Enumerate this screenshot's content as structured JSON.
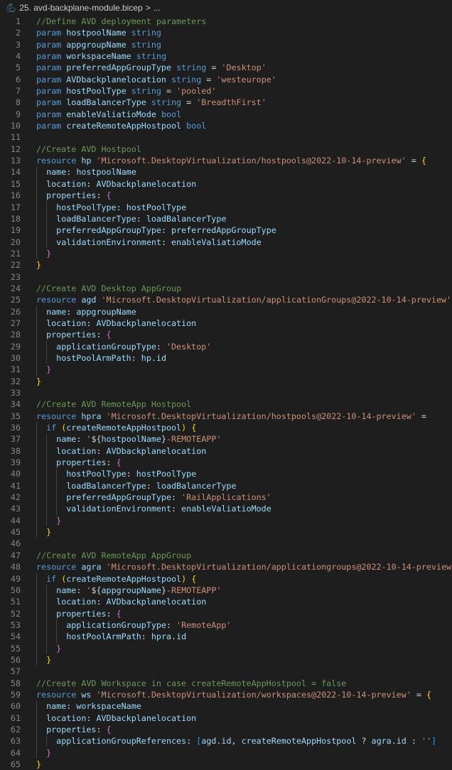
{
  "breadcrumb": {
    "file_icon": "bicep-icon",
    "file_name": "25. avd-backplane-module.bicep",
    "separator": ">",
    "more": "..."
  },
  "colors": {
    "comment": "#6a9955",
    "keyword": "#569cd6",
    "identifier": "#9cdcfe",
    "string": "#ce9178",
    "punctuation": "#d4d4d4",
    "bracket1": "#ffd700",
    "bracket2": "#da70d6",
    "bracket3": "#179fff",
    "line_number": "#858585",
    "background": "#1e1e1e"
  },
  "lines": [
    {
      "n": "1",
      "indent": 0,
      "tokens": [
        [
          "c",
          "//Define AVD deployment parameters"
        ]
      ]
    },
    {
      "n": "2",
      "indent": 0,
      "tokens": [
        [
          "k",
          "param"
        ],
        [
          "p",
          " "
        ],
        [
          "i",
          "hostpoolName"
        ],
        [
          "p",
          " "
        ],
        [
          "k",
          "string"
        ]
      ]
    },
    {
      "n": "3",
      "indent": 0,
      "tokens": [
        [
          "k",
          "param"
        ],
        [
          "p",
          " "
        ],
        [
          "i",
          "appgroupName"
        ],
        [
          "p",
          " "
        ],
        [
          "k",
          "string"
        ]
      ]
    },
    {
      "n": "4",
      "indent": 0,
      "tokens": [
        [
          "k",
          "param"
        ],
        [
          "p",
          " "
        ],
        [
          "i",
          "workspaceName"
        ],
        [
          "p",
          " "
        ],
        [
          "k",
          "string"
        ]
      ]
    },
    {
      "n": "5",
      "indent": 0,
      "tokens": [
        [
          "k",
          "param"
        ],
        [
          "p",
          " "
        ],
        [
          "i",
          "preferredAppGroupType"
        ],
        [
          "p",
          " "
        ],
        [
          "k",
          "string"
        ],
        [
          "p",
          " = "
        ],
        [
          "s",
          "'Desktop'"
        ]
      ]
    },
    {
      "n": "6",
      "indent": 0,
      "tokens": [
        [
          "k",
          "param"
        ],
        [
          "p",
          " "
        ],
        [
          "i",
          "AVDbackplanelocation"
        ],
        [
          "p",
          " "
        ],
        [
          "k",
          "string"
        ],
        [
          "p",
          " = "
        ],
        [
          "s",
          "'westeurope'"
        ]
      ]
    },
    {
      "n": "7",
      "indent": 0,
      "tokens": [
        [
          "k",
          "param"
        ],
        [
          "p",
          " "
        ],
        [
          "i",
          "hostPoolType"
        ],
        [
          "p",
          " "
        ],
        [
          "k",
          "string"
        ],
        [
          "p",
          " = "
        ],
        [
          "s",
          "'pooled'"
        ]
      ]
    },
    {
      "n": "8",
      "indent": 0,
      "tokens": [
        [
          "k",
          "param"
        ],
        [
          "p",
          " "
        ],
        [
          "i",
          "loadBalancerType"
        ],
        [
          "p",
          " "
        ],
        [
          "k",
          "string"
        ],
        [
          "p",
          " = "
        ],
        [
          "s",
          "'BreadthFirst'"
        ]
      ]
    },
    {
      "n": "9",
      "indent": 0,
      "tokens": [
        [
          "k",
          "param"
        ],
        [
          "p",
          " "
        ],
        [
          "i",
          "enableValiatioMode"
        ],
        [
          "p",
          " "
        ],
        [
          "k",
          "bool"
        ]
      ]
    },
    {
      "n": "10",
      "indent": 0,
      "tokens": [
        [
          "k",
          "param"
        ],
        [
          "p",
          " "
        ],
        [
          "i",
          "createRemoteAppHostpool"
        ],
        [
          "p",
          " "
        ],
        [
          "k",
          "bool"
        ]
      ]
    },
    {
      "n": "11",
      "indent": 0,
      "tokens": []
    },
    {
      "n": "12",
      "indent": 0,
      "tokens": [
        [
          "c",
          "//Create AVD Hostpool"
        ]
      ]
    },
    {
      "n": "13",
      "indent": 0,
      "tokens": [
        [
          "k",
          "resource"
        ],
        [
          "p",
          " "
        ],
        [
          "i",
          "hp"
        ],
        [
          "p",
          " "
        ],
        [
          "s",
          "'Microsoft.DesktopVirtualization/hostpools@2022-10-14-preview'"
        ],
        [
          "p",
          " = "
        ],
        [
          "b1",
          "{"
        ]
      ]
    },
    {
      "n": "14",
      "indent": 1,
      "tokens": [
        [
          "p",
          "  "
        ],
        [
          "i",
          "name"
        ],
        [
          "p",
          ": "
        ],
        [
          "i",
          "hostpoolName"
        ]
      ]
    },
    {
      "n": "15",
      "indent": 1,
      "tokens": [
        [
          "p",
          "  "
        ],
        [
          "i",
          "location"
        ],
        [
          "p",
          ": "
        ],
        [
          "i",
          "AVDbackplanelocation"
        ]
      ]
    },
    {
      "n": "16",
      "indent": 1,
      "tokens": [
        [
          "p",
          "  "
        ],
        [
          "i",
          "properties"
        ],
        [
          "p",
          ": "
        ],
        [
          "b2",
          "{"
        ]
      ]
    },
    {
      "n": "17",
      "indent": 2,
      "tokens": [
        [
          "p",
          "    "
        ],
        [
          "i",
          "hostPoolType"
        ],
        [
          "p",
          ": "
        ],
        [
          "i",
          "hostPoolType"
        ]
      ]
    },
    {
      "n": "18",
      "indent": 2,
      "tokens": [
        [
          "p",
          "    "
        ],
        [
          "i",
          "loadBalancerType"
        ],
        [
          "p",
          ": "
        ],
        [
          "i",
          "loadBalancerType"
        ]
      ]
    },
    {
      "n": "19",
      "indent": 2,
      "tokens": [
        [
          "p",
          "    "
        ],
        [
          "i",
          "preferredAppGroupType"
        ],
        [
          "p",
          ": "
        ],
        [
          "i",
          "preferredAppGroupType"
        ]
      ]
    },
    {
      "n": "20",
      "indent": 2,
      "tokens": [
        [
          "p",
          "    "
        ],
        [
          "i",
          "validationEnvironment"
        ],
        [
          "p",
          ": "
        ],
        [
          "i",
          "enableValiatioMode"
        ]
      ]
    },
    {
      "n": "21",
      "indent": 1,
      "tokens": [
        [
          "p",
          "  "
        ],
        [
          "b2",
          "}"
        ]
      ]
    },
    {
      "n": "22",
      "indent": 0,
      "tokens": [
        [
          "b1",
          "}"
        ]
      ]
    },
    {
      "n": "23",
      "indent": 0,
      "tokens": []
    },
    {
      "n": "24",
      "indent": 0,
      "tokens": [
        [
          "c",
          "//Create AVD Desktop AppGroup"
        ]
      ]
    },
    {
      "n": "25",
      "indent": 0,
      "tokens": [
        [
          "k",
          "resource"
        ],
        [
          "p",
          " "
        ],
        [
          "i",
          "agd"
        ],
        [
          "p",
          " "
        ],
        [
          "s",
          "'Microsoft.DesktopVirtualization/applicationGroups@2022-10-14-preview'"
        ],
        [
          "p",
          " = "
        ],
        [
          "b1",
          "{"
        ]
      ]
    },
    {
      "n": "26",
      "indent": 1,
      "tokens": [
        [
          "p",
          "  "
        ],
        [
          "i",
          "name"
        ],
        [
          "p",
          ": "
        ],
        [
          "i",
          "appgroupName"
        ]
      ]
    },
    {
      "n": "27",
      "indent": 1,
      "tokens": [
        [
          "p",
          "  "
        ],
        [
          "i",
          "location"
        ],
        [
          "p",
          ": "
        ],
        [
          "i",
          "AVDbackplanelocation"
        ]
      ]
    },
    {
      "n": "28",
      "indent": 1,
      "tokens": [
        [
          "p",
          "  "
        ],
        [
          "i",
          "properties"
        ],
        [
          "p",
          ": "
        ],
        [
          "b2",
          "{"
        ]
      ]
    },
    {
      "n": "29",
      "indent": 2,
      "tokens": [
        [
          "p",
          "    "
        ],
        [
          "i",
          "applicationGroupType"
        ],
        [
          "p",
          ": "
        ],
        [
          "s",
          "'Desktop'"
        ]
      ]
    },
    {
      "n": "30",
      "indent": 2,
      "tokens": [
        [
          "p",
          "    "
        ],
        [
          "i",
          "hostPoolArmPath"
        ],
        [
          "p",
          ": "
        ],
        [
          "i",
          "hp"
        ],
        [
          "p",
          "."
        ],
        [
          "i",
          "id"
        ]
      ]
    },
    {
      "n": "31",
      "indent": 1,
      "tokens": [
        [
          "p",
          "  "
        ],
        [
          "b2",
          "}"
        ]
      ]
    },
    {
      "n": "32",
      "indent": 0,
      "tokens": [
        [
          "b1",
          "}"
        ]
      ]
    },
    {
      "n": "33",
      "indent": 0,
      "tokens": []
    },
    {
      "n": "34",
      "indent": 0,
      "tokens": [
        [
          "c",
          "//Create AVD RemoteApp Hostpool"
        ]
      ]
    },
    {
      "n": "35",
      "indent": 0,
      "tokens": [
        [
          "k",
          "resource"
        ],
        [
          "p",
          " "
        ],
        [
          "i",
          "hpra"
        ],
        [
          "p",
          " "
        ],
        [
          "s",
          "'Microsoft.DesktopVirtualization/hostpools@2022-10-14-preview'"
        ],
        [
          "p",
          " ="
        ]
      ]
    },
    {
      "n": "36",
      "indent": 1,
      "tokens": [
        [
          "p",
          "  "
        ],
        [
          "k",
          "if"
        ],
        [
          "p",
          " "
        ],
        [
          "b1",
          "("
        ],
        [
          "i",
          "createRemoteAppHostpool"
        ],
        [
          "b1",
          ")"
        ],
        [
          "p",
          " "
        ],
        [
          "b1",
          "{"
        ]
      ]
    },
    {
      "n": "37",
      "indent": 2,
      "tokens": [
        [
          "p",
          "    "
        ],
        [
          "i",
          "name"
        ],
        [
          "p",
          ": "
        ],
        [
          "s",
          "'"
        ],
        [
          "p",
          "${"
        ],
        [
          "i",
          "hostpoolName"
        ],
        [
          "p",
          "}"
        ],
        [
          "s",
          "-REMOTEAPP'"
        ]
      ]
    },
    {
      "n": "38",
      "indent": 2,
      "tokens": [
        [
          "p",
          "    "
        ],
        [
          "i",
          "location"
        ],
        [
          "p",
          ": "
        ],
        [
          "i",
          "AVDbackplanelocation"
        ]
      ]
    },
    {
      "n": "39",
      "indent": 2,
      "tokens": [
        [
          "p",
          "    "
        ],
        [
          "i",
          "properties"
        ],
        [
          "p",
          ": "
        ],
        [
          "b2",
          "{"
        ]
      ]
    },
    {
      "n": "40",
      "indent": 3,
      "tokens": [
        [
          "p",
          "      "
        ],
        [
          "i",
          "hostPoolType"
        ],
        [
          "p",
          ": "
        ],
        [
          "i",
          "hostPoolType"
        ]
      ]
    },
    {
      "n": "41",
      "indent": 3,
      "tokens": [
        [
          "p",
          "      "
        ],
        [
          "i",
          "loadBalancerType"
        ],
        [
          "p",
          ": "
        ],
        [
          "i",
          "loadBalancerType"
        ]
      ]
    },
    {
      "n": "42",
      "indent": 3,
      "tokens": [
        [
          "p",
          "      "
        ],
        [
          "i",
          "preferredAppGroupType"
        ],
        [
          "p",
          ": "
        ],
        [
          "s",
          "'RailApplications'"
        ]
      ]
    },
    {
      "n": "43",
      "indent": 3,
      "tokens": [
        [
          "p",
          "      "
        ],
        [
          "i",
          "validationEnvironment"
        ],
        [
          "p",
          ": "
        ],
        [
          "i",
          "enableValiatioMode"
        ]
      ]
    },
    {
      "n": "44",
      "indent": 2,
      "tokens": [
        [
          "p",
          "    "
        ],
        [
          "b2",
          "}"
        ]
      ]
    },
    {
      "n": "45",
      "indent": 1,
      "tokens": [
        [
          "p",
          "  "
        ],
        [
          "b1",
          "}"
        ]
      ]
    },
    {
      "n": "46",
      "indent": 0,
      "tokens": []
    },
    {
      "n": "47",
      "indent": 0,
      "tokens": [
        [
          "c",
          "//Create AVD RemoteApp AppGroup"
        ]
      ]
    },
    {
      "n": "48",
      "indent": 0,
      "tokens": [
        [
          "k",
          "resource"
        ],
        [
          "p",
          " "
        ],
        [
          "i",
          "agra"
        ],
        [
          "p",
          " "
        ],
        [
          "s",
          "'Microsoft.DesktopVirtualization/applicationgroups@2022-10-14-preview'"
        ],
        [
          "p",
          " ="
        ]
      ]
    },
    {
      "n": "49",
      "indent": 1,
      "tokens": [
        [
          "p",
          "  "
        ],
        [
          "k",
          "if"
        ],
        [
          "p",
          " "
        ],
        [
          "b1",
          "("
        ],
        [
          "i",
          "createRemoteAppHostpool"
        ],
        [
          "b1",
          ")"
        ],
        [
          "p",
          " "
        ],
        [
          "b1",
          "{"
        ]
      ]
    },
    {
      "n": "50",
      "indent": 2,
      "tokens": [
        [
          "p",
          "    "
        ],
        [
          "i",
          "name"
        ],
        [
          "p",
          ": "
        ],
        [
          "s",
          "'"
        ],
        [
          "p",
          "${"
        ],
        [
          "i",
          "appgroupName"
        ],
        [
          "p",
          "}"
        ],
        [
          "s",
          "-REMOTEAPP'"
        ]
      ]
    },
    {
      "n": "51",
      "indent": 2,
      "tokens": [
        [
          "p",
          "    "
        ],
        [
          "i",
          "location"
        ],
        [
          "p",
          ": "
        ],
        [
          "i",
          "AVDbackplanelocation"
        ]
      ]
    },
    {
      "n": "52",
      "indent": 2,
      "tokens": [
        [
          "p",
          "    "
        ],
        [
          "i",
          "properties"
        ],
        [
          "p",
          ": "
        ],
        [
          "b2",
          "{"
        ]
      ]
    },
    {
      "n": "53",
      "indent": 3,
      "tokens": [
        [
          "p",
          "      "
        ],
        [
          "i",
          "applicationGroupType"
        ],
        [
          "p",
          ": "
        ],
        [
          "s",
          "'RemoteApp'"
        ]
      ]
    },
    {
      "n": "54",
      "indent": 3,
      "tokens": [
        [
          "p",
          "      "
        ],
        [
          "i",
          "hostPoolArmPath"
        ],
        [
          "p",
          ": "
        ],
        [
          "i",
          "hpra"
        ],
        [
          "p",
          "."
        ],
        [
          "i",
          "id"
        ]
      ]
    },
    {
      "n": "55",
      "indent": 2,
      "tokens": [
        [
          "p",
          "    "
        ],
        [
          "b2",
          "}"
        ]
      ]
    },
    {
      "n": "56",
      "indent": 1,
      "tokens": [
        [
          "p",
          "  "
        ],
        [
          "b1",
          "}"
        ]
      ]
    },
    {
      "n": "57",
      "indent": 0,
      "tokens": []
    },
    {
      "n": "58",
      "indent": 0,
      "tokens": [
        [
          "c",
          "//Create AVD Workspace in case createRemoteAppHostpool = false"
        ]
      ]
    },
    {
      "n": "59",
      "indent": 0,
      "tokens": [
        [
          "k",
          "resource"
        ],
        [
          "p",
          " "
        ],
        [
          "i",
          "ws"
        ],
        [
          "p",
          " "
        ],
        [
          "s",
          "'Microsoft.DesktopVirtualization/workspaces@2022-10-14-preview'"
        ],
        [
          "p",
          " = "
        ],
        [
          "b1",
          "{"
        ]
      ]
    },
    {
      "n": "60",
      "indent": 1,
      "tokens": [
        [
          "p",
          "  "
        ],
        [
          "i",
          "name"
        ],
        [
          "p",
          ": "
        ],
        [
          "i",
          "workspaceName"
        ]
      ]
    },
    {
      "n": "61",
      "indent": 1,
      "tokens": [
        [
          "p",
          "  "
        ],
        [
          "i",
          "location"
        ],
        [
          "p",
          ": "
        ],
        [
          "i",
          "AVDbackplanelocation"
        ]
      ]
    },
    {
      "n": "62",
      "indent": 1,
      "tokens": [
        [
          "p",
          "  "
        ],
        [
          "i",
          "properties"
        ],
        [
          "p",
          ": "
        ],
        [
          "b2",
          "{"
        ]
      ]
    },
    {
      "n": "63",
      "indent": 2,
      "tokens": [
        [
          "p",
          "    "
        ],
        [
          "i",
          "applicationGroupReferences"
        ],
        [
          "p",
          ": "
        ],
        [
          "b3",
          "["
        ],
        [
          "i",
          "agd"
        ],
        [
          "p",
          "."
        ],
        [
          "i",
          "id"
        ],
        [
          "p",
          ", "
        ],
        [
          "i",
          "createRemoteAppHostpool"
        ],
        [
          "p",
          " ? "
        ],
        [
          "i",
          "agra"
        ],
        [
          "p",
          "."
        ],
        [
          "i",
          "id"
        ],
        [
          "p",
          " : "
        ],
        [
          "s",
          "''"
        ],
        [
          "b3",
          "]"
        ]
      ]
    },
    {
      "n": "64",
      "indent": 1,
      "tokens": [
        [
          "p",
          "  "
        ],
        [
          "b2",
          "}"
        ]
      ]
    },
    {
      "n": "65",
      "indent": 0,
      "tokens": [
        [
          "b1",
          "}"
        ]
      ]
    }
  ]
}
